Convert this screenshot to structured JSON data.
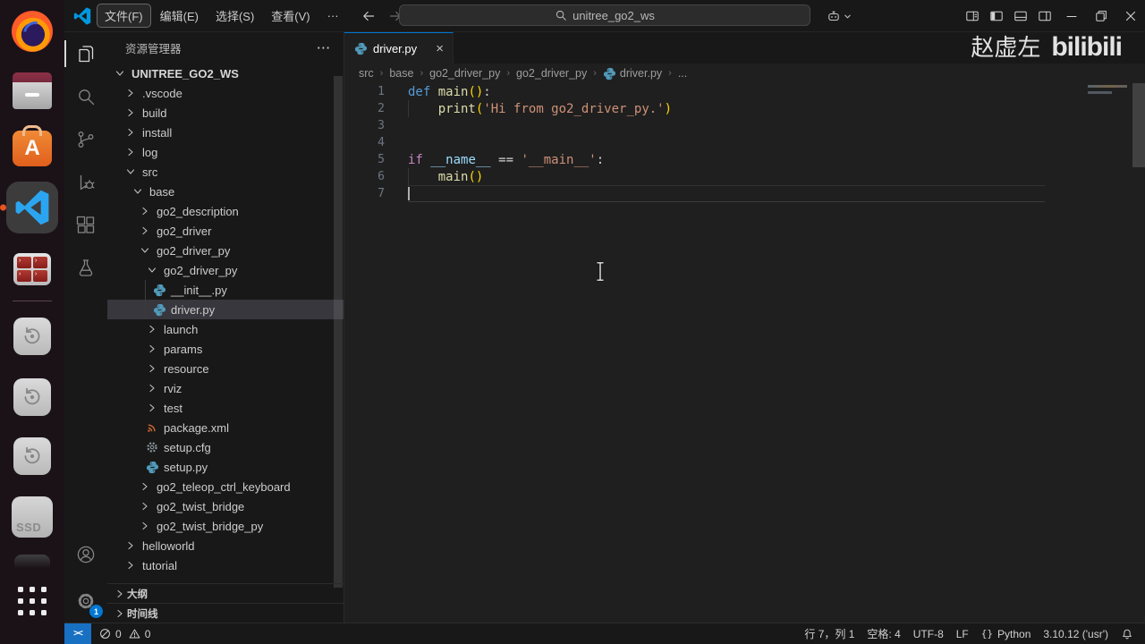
{
  "titlebar": {
    "menus": [
      {
        "name": "menu-file",
        "label": "文件(F)",
        "active": true
      },
      {
        "name": "menu-edit",
        "label": "编辑(E)"
      },
      {
        "name": "menu-selection",
        "label": "选择(S)"
      },
      {
        "name": "menu-view",
        "label": "查看(V)"
      },
      {
        "name": "menu-more",
        "label": "···"
      }
    ],
    "search": {
      "value": "unitree_go2_ws"
    },
    "window_controls": [
      "customize-layout",
      "toggle-primary-sidebar",
      "toggle-panel",
      "toggle-secondary-sidebar",
      "minimize",
      "restore",
      "close"
    ]
  },
  "dock": {
    "items": [
      {
        "name": "firefox"
      },
      {
        "name": "file-manager"
      },
      {
        "name": "ubuntu-software"
      },
      {
        "name": "vscode",
        "running": true
      },
      {
        "name": "terminator-terminal"
      },
      {
        "name": "divider"
      },
      {
        "name": "removable-media-1"
      },
      {
        "name": "removable-media-2"
      },
      {
        "name": "removable-media-3"
      },
      {
        "name": "ssd-drive",
        "label": "SSD"
      },
      {
        "name": "hidden-app"
      },
      {
        "name": "app-grid"
      }
    ]
  },
  "activity_bar": {
    "top": [
      {
        "name": "explorer",
        "active": true
      },
      {
        "name": "search"
      },
      {
        "name": "source-control"
      },
      {
        "name": "run-and-debug"
      },
      {
        "name": "extensions"
      },
      {
        "name": "testing"
      }
    ],
    "bottom": [
      {
        "name": "account"
      },
      {
        "name": "settings",
        "badge": "1"
      }
    ]
  },
  "sidebar": {
    "title": "资源管理器",
    "actions": "···",
    "root": {
      "label": "UNITREE_GO2_WS"
    },
    "tree": [
      {
        "label": ".vscode",
        "level": 1,
        "kind": "folder",
        "state": "collapsed"
      },
      {
        "label": "build",
        "level": 1,
        "kind": "folder",
        "state": "collapsed"
      },
      {
        "label": "install",
        "level": 1,
        "kind": "folder",
        "state": "collapsed"
      },
      {
        "label": "log",
        "level": 1,
        "kind": "folder",
        "state": "collapsed"
      },
      {
        "label": "src",
        "level": 1,
        "kind": "folder",
        "state": "expanded"
      },
      {
        "label": "base",
        "level": 2,
        "kind": "folder",
        "state": "expanded"
      },
      {
        "label": "go2_description",
        "level": 3,
        "kind": "folder",
        "state": "collapsed"
      },
      {
        "label": "go2_driver",
        "level": 3,
        "kind": "folder",
        "state": "collapsed"
      },
      {
        "label": "go2_driver_py",
        "level": 3,
        "kind": "folder",
        "state": "expanded"
      },
      {
        "label": "go2_driver_py",
        "level": 4,
        "kind": "folder",
        "state": "expanded"
      },
      {
        "label": "__init__.py",
        "level": 5,
        "kind": "file",
        "icon": "python"
      },
      {
        "label": "driver.py",
        "level": 5,
        "kind": "file",
        "icon": "python",
        "selected": true
      },
      {
        "label": "launch",
        "level": 4,
        "kind": "folder",
        "state": "collapsed"
      },
      {
        "label": "params",
        "level": 4,
        "kind": "folder",
        "state": "collapsed"
      },
      {
        "label": "resource",
        "level": 4,
        "kind": "folder",
        "state": "collapsed"
      },
      {
        "label": "rviz",
        "level": 4,
        "kind": "folder",
        "state": "collapsed"
      },
      {
        "label": "test",
        "level": 4,
        "kind": "folder",
        "state": "collapsed"
      },
      {
        "label": "package.xml",
        "level": 4,
        "kind": "file",
        "icon": "xml"
      },
      {
        "label": "setup.cfg",
        "level": 4,
        "kind": "file",
        "icon": "config"
      },
      {
        "label": "setup.py",
        "level": 4,
        "kind": "file",
        "icon": "python"
      },
      {
        "label": "go2_teleop_ctrl_keyboard",
        "level": 3,
        "kind": "folder",
        "state": "collapsed"
      },
      {
        "label": "go2_twist_bridge",
        "level": 3,
        "kind": "folder",
        "state": "collapsed"
      },
      {
        "label": "go2_twist_bridge_py",
        "level": 3,
        "kind": "folder",
        "state": "collapsed"
      },
      {
        "label": "helloworld",
        "level": 1,
        "kind": "folder",
        "state": "collapsed"
      },
      {
        "label": "tutorial",
        "level": 1,
        "kind": "folder",
        "state": "collapsed"
      }
    ],
    "sections": [
      {
        "name": "outline",
        "label": "大纲"
      },
      {
        "name": "timeline",
        "label": "时间线"
      }
    ]
  },
  "editor": {
    "tab": {
      "label": "driver.py",
      "icon": "python",
      "close": "×"
    },
    "breadcrumbs": [
      {
        "label": "src"
      },
      {
        "label": "base"
      },
      {
        "label": "go2_driver_py"
      },
      {
        "label": "go2_driver_py"
      },
      {
        "label": "driver.py",
        "icon": "python"
      },
      {
        "label": "..."
      }
    ],
    "code": {
      "language": "python",
      "lines": [
        {
          "n": "1",
          "tokens": [
            [
              "kw",
              "def "
            ],
            [
              "fn",
              "main"
            ],
            [
              "b1",
              "()"
            ],
            [
              "pn",
              ":"
            ]
          ]
        },
        {
          "n": "2",
          "tokens": [
            [
              "pn",
              "    "
            ],
            [
              "fn",
              "print"
            ],
            [
              "b1",
              "("
            ],
            [
              "str",
              "'Hi from go2_driver_py.'"
            ],
            [
              "b1",
              ")"
            ]
          ],
          "indent_guide": true
        },
        {
          "n": "3",
          "tokens": []
        },
        {
          "n": "4",
          "tokens": []
        },
        {
          "n": "5",
          "tokens": [
            [
              "kw2",
              "if "
            ],
            [
              "var",
              "__name__"
            ],
            [
              "pn",
              " == "
            ],
            [
              "str",
              "'__main__'"
            ],
            [
              "pn",
              ":"
            ]
          ]
        },
        {
          "n": "6",
          "tokens": [
            [
              "pn",
              "    "
            ],
            [
              "fn",
              "main"
            ],
            [
              "b1",
              "()"
            ]
          ],
          "indent_guide": true
        },
        {
          "n": "7",
          "tokens": [],
          "current": true
        }
      ]
    }
  },
  "status_bar": {
    "remote": {
      "name": "remote-indicator",
      "glyph": "><"
    },
    "problems": {
      "errors": "0",
      "warnings": "0"
    },
    "right": [
      {
        "name": "cursor-position",
        "label": "行 7，列 1"
      },
      {
        "name": "indentation",
        "label": "空格: 4"
      },
      {
        "name": "encoding",
        "label": "UTF-8"
      },
      {
        "name": "eol",
        "label": "LF"
      },
      {
        "name": "language-mode",
        "label": "Python",
        "icon": "braces"
      },
      {
        "name": "python-interpreter",
        "label": "3.10.12 ('usr')"
      },
      {
        "name": "notifications",
        "icon": "bell"
      }
    ]
  },
  "watermark": {
    "author": "赵虚左",
    "brand": "bilibili"
  }
}
